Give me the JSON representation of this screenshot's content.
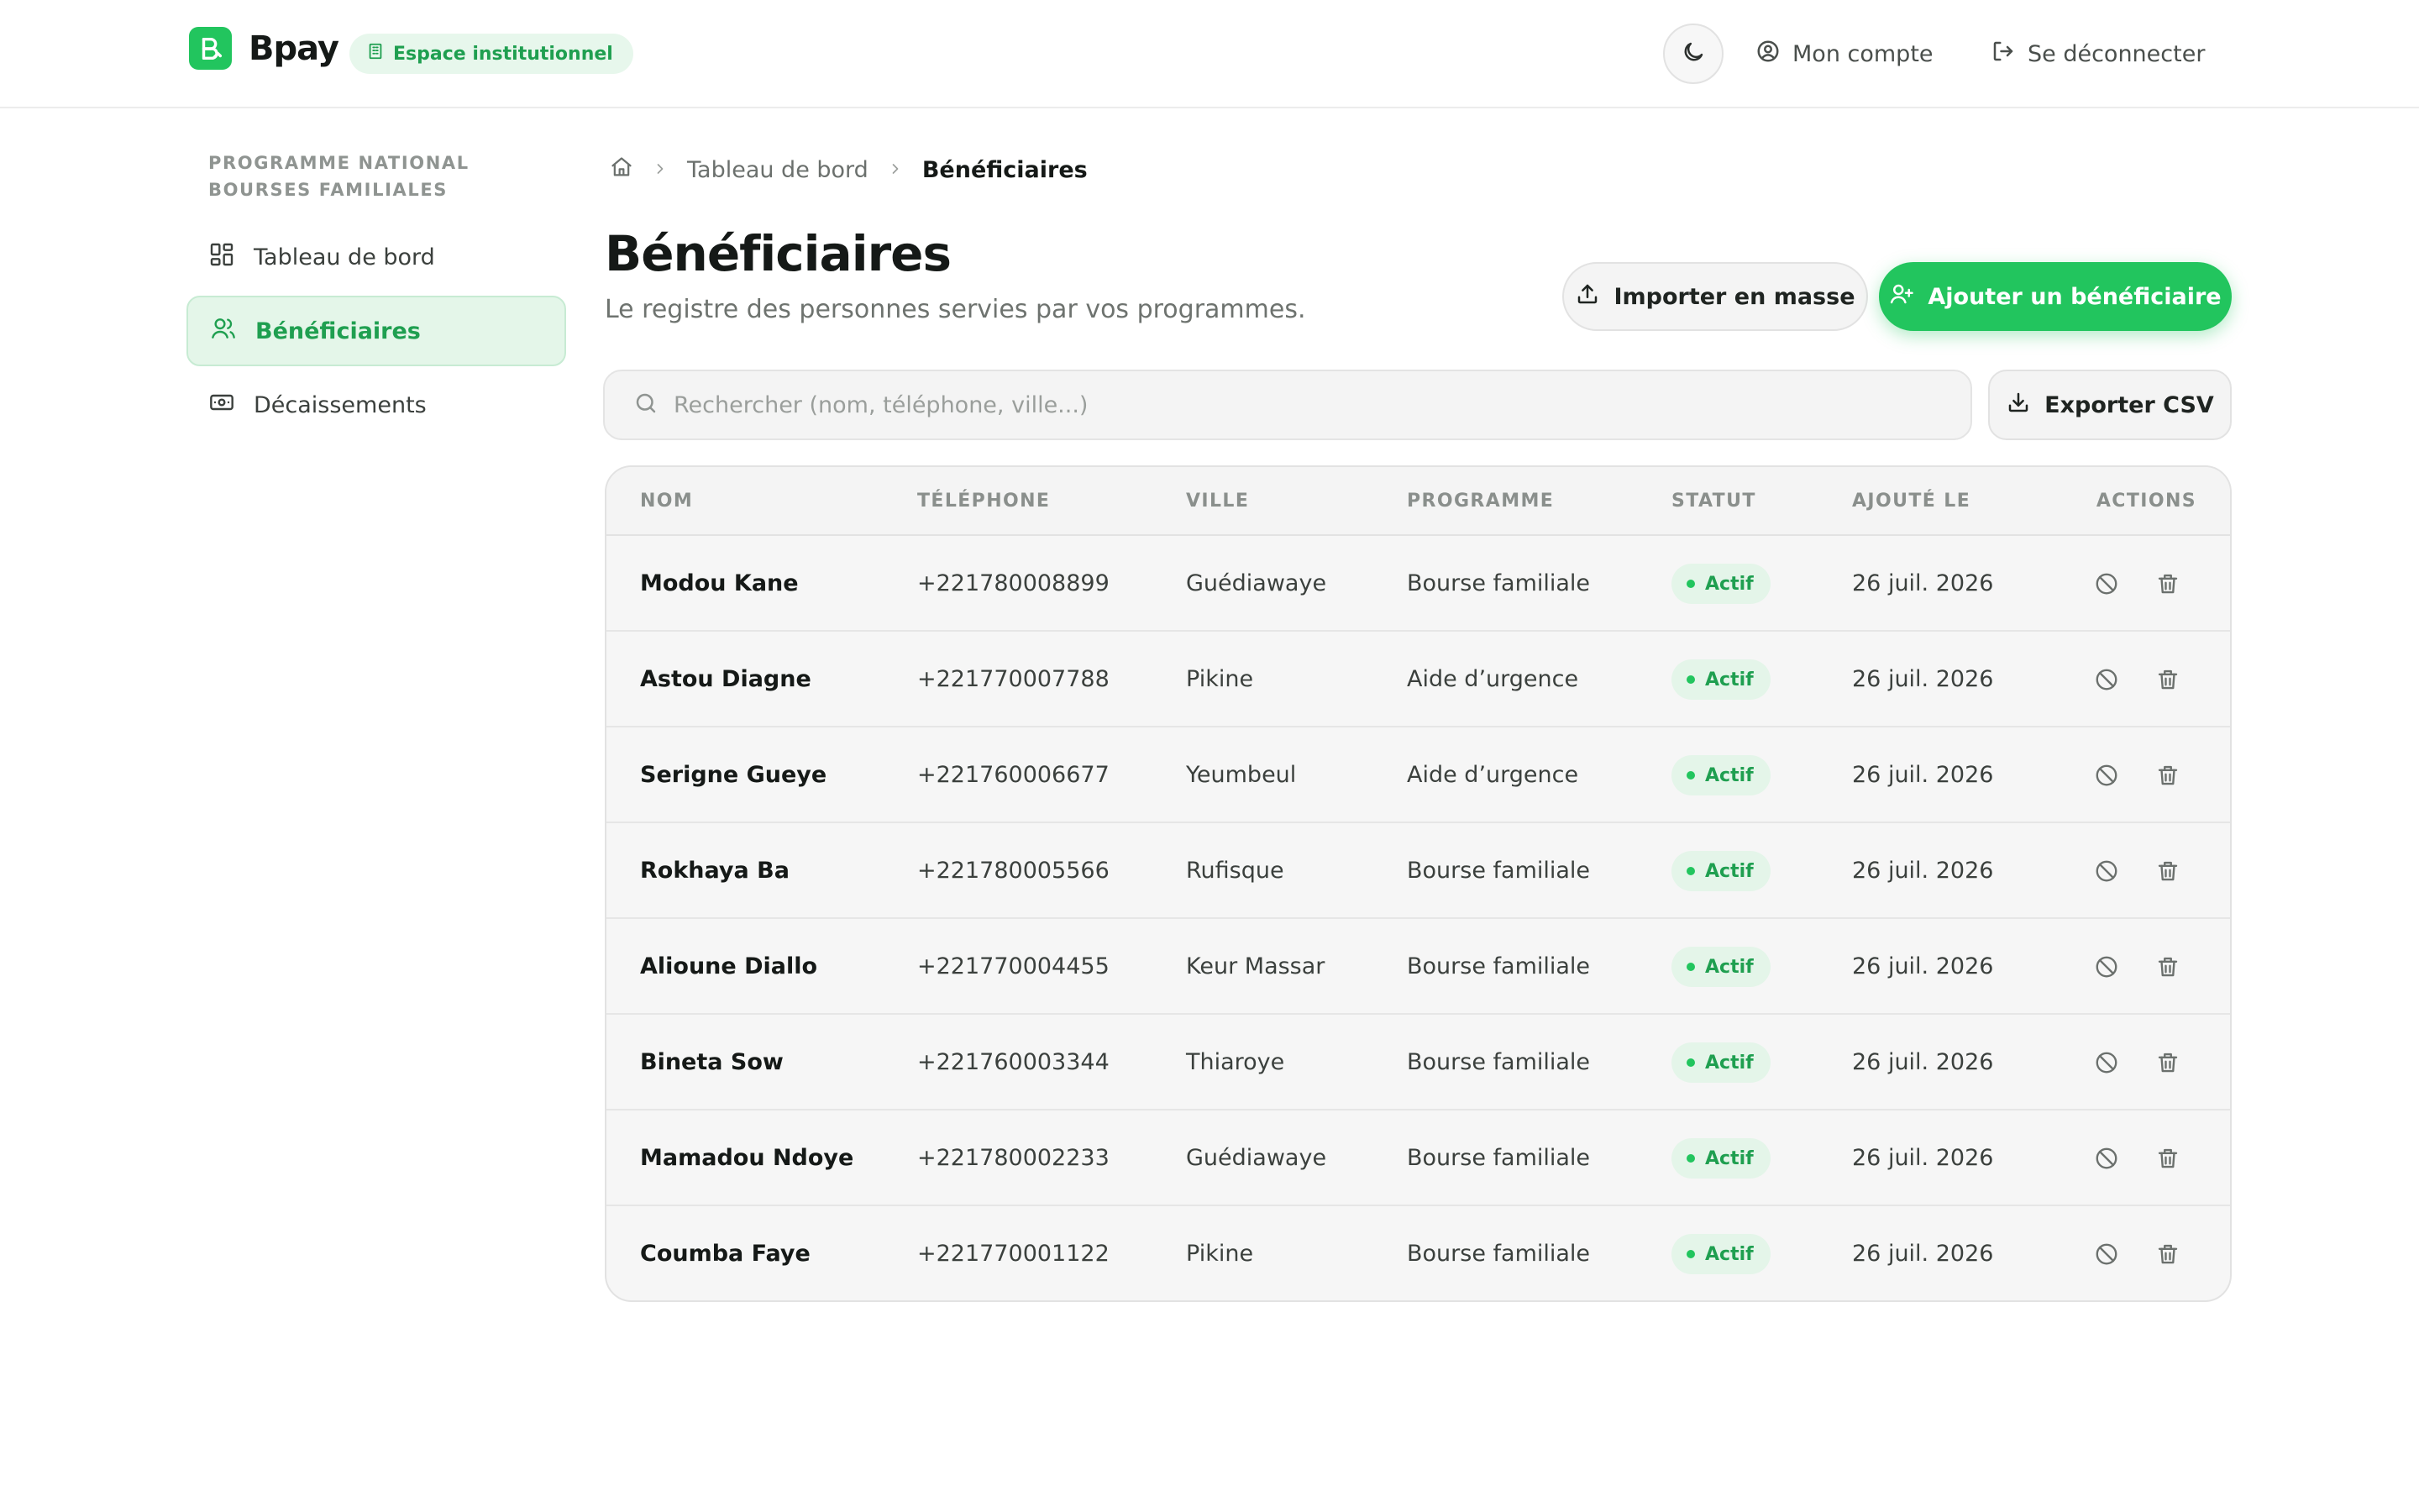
{
  "header": {
    "brand": "Bpay",
    "espace_badge": "Espace institutionnel",
    "account_label": "Mon compte",
    "logout_label": "Se déconnecter"
  },
  "sidebar": {
    "caption_line1": "PROGRAMME NATIONAL",
    "caption_line2": "BOURSES FAMILIALES",
    "items": [
      {
        "label": "Tableau de bord",
        "icon": "dashboard-icon",
        "active": false
      },
      {
        "label": "Bénéficiaires",
        "icon": "users-icon",
        "active": true
      },
      {
        "label": "Décaissements",
        "icon": "banknote-icon",
        "active": false
      }
    ]
  },
  "breadcrumb": {
    "parent": "Tableau de bord",
    "current": "Bénéficiaires"
  },
  "page": {
    "title": "Bénéficiaires",
    "subtitle": "Le registre des personnes servies par vos programmes."
  },
  "actions": {
    "import_label": "Importer en masse",
    "add_label": "Ajouter un bénéficiaire",
    "export_label": "Exporter CSV"
  },
  "search": {
    "placeholder": "Rechercher (nom, téléphone, ville...)",
    "value": ""
  },
  "table": {
    "columns": {
      "name": "NOM",
      "phone": "TÉLÉPHONE",
      "city": "VILLE",
      "program": "PROGRAMME",
      "status": "STATUT",
      "added": "AJOUTÉ LE",
      "actions": "ACTIONS"
    },
    "rows": [
      {
        "name": "Modou Kane",
        "phone": "+221780008899",
        "city": "Guédiawaye",
        "program": "Bourse familiale",
        "status": "Actif",
        "added": "26 juil. 2026"
      },
      {
        "name": "Astou Diagne",
        "phone": "+221770007788",
        "city": "Pikine",
        "program": "Aide d’urgence",
        "status": "Actif",
        "added": "26 juil. 2026"
      },
      {
        "name": "Serigne Gueye",
        "phone": "+221760006677",
        "city": "Yeumbeul",
        "program": "Aide d’urgence",
        "status": "Actif",
        "added": "26 juil. 2026"
      },
      {
        "name": "Rokhaya Ba",
        "phone": "+221780005566",
        "city": "Rufisque",
        "program": "Bourse familiale",
        "status": "Actif",
        "added": "26 juil. 2026"
      },
      {
        "name": "Alioune Diallo",
        "phone": "+221770004455",
        "city": "Keur Massar",
        "program": "Bourse familiale",
        "status": "Actif",
        "added": "26 juil. 2026"
      },
      {
        "name": "Bineta Sow",
        "phone": "+221760003344",
        "city": "Thiaroye",
        "program": "Bourse familiale",
        "status": "Actif",
        "added": "26 juil. 2026"
      },
      {
        "name": "Mamadou Ndoye",
        "phone": "+221780002233",
        "city": "Guédiawaye",
        "program": "Bourse familiale",
        "status": "Actif",
        "added": "26 juil. 2026"
      },
      {
        "name": "Coumba Faye",
        "phone": "+221770001122",
        "city": "Pikine",
        "program": "Bourse familiale",
        "status": "Actif",
        "added": "26 juil. 2026"
      }
    ]
  },
  "colors": {
    "accent": "#22c55e",
    "accent_text": "#1f9f50",
    "accent_soft": "#e4f6e9"
  }
}
